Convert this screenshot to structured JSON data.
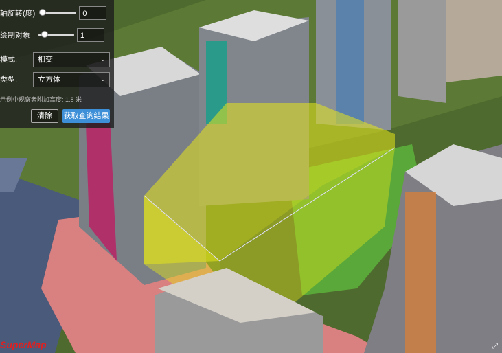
{
  "panel": {
    "rotate_label": "轴旋转(度)",
    "rotate_value": 0,
    "rotate_slider_fraction": 0.0,
    "draw_label": "绘制对象",
    "draw_value": 1,
    "draw_slider_fraction": 0.1,
    "mode_label": "模式:",
    "mode_value": "相交",
    "type_label": "类型:",
    "type_value": "立方体",
    "hint": "示例中观察者附加高度: 1.8 米",
    "clear_button": "清除",
    "query_button": "获取查询结果"
  },
  "colors": {
    "query_volume": "#e6e619",
    "button_primary": "#3d8fd8"
  }
}
